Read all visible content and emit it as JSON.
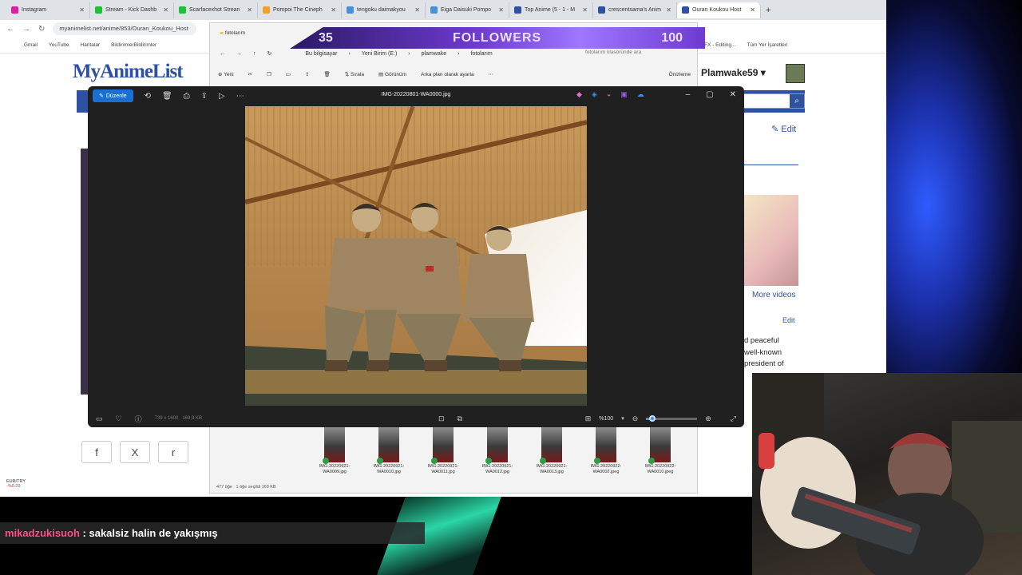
{
  "browser": {
    "tabs": [
      {
        "label": "Instagram",
        "color": "#d6249f"
      },
      {
        "label": "Stream - Kick Dashb",
        "color": "#1fbf3a"
      },
      {
        "label": "Scarfacexhot Strean",
        "color": "#1fbf3a"
      },
      {
        "label": "Pompoi The Cineph",
        "color": "#f0a030"
      },
      {
        "label": "tengoku daimakyou",
        "color": "#4a90d9"
      },
      {
        "label": "Eiga Daisuki Pompo",
        "color": "#4a90d9"
      },
      {
        "label": "Top Anime (5 - 1 - M",
        "color": "#2e51a2"
      },
      {
        "label": "crescentsama's Anim",
        "color": "#2e51a2"
      },
      {
        "label": "Ouran Koukou Host",
        "color": "#2e51a2"
      }
    ],
    "url": "myanimelist.net/anime/853/Ouran_Koukou_Host",
    "bookmarks": [
      "Gmail",
      "YouTube",
      "Haritalar",
      "BildirimlerBildirimler",
      "MATESFX - Editing...",
      "Tüm Yer İşaretleri"
    ]
  },
  "mal": {
    "logo": "MyAnimeList",
    "username": "Plamwake59",
    "edit": "Edit",
    "more_videos": "More videos",
    "edit2": "Edit",
    "synopsis": [
      "d peaceful",
      "well-known",
      "president of"
    ],
    "share_icons": [
      "f",
      "X",
      "r"
    ]
  },
  "eurtry": {
    "label": "EUR/TRY",
    "delta": "-%0.29"
  },
  "explorer": {
    "title": "fotolarım",
    "followers": {
      "left": "35",
      "label": "FOLLOWERS",
      "right": "100"
    },
    "breadcrumb": [
      "Bu bilgisayar",
      "Yeni Birim (E:)",
      "plamwake",
      "fotolarım"
    ],
    "search_placeholder": "fotolarım klasöründe ara",
    "toolbar": {
      "new": "Yeni",
      "sort": "Sırala",
      "view": "Görünüm",
      "background": "Arka plan olarak ayarla",
      "preview": "Önizleme"
    },
    "thumbnails": [
      "IMG-20220921-WA0009.jpg",
      "IMG-20220921-WA0010.jpg",
      "IMG-20220921-WA0011.jpg",
      "IMG-20220921-WA0012.jpg",
      "IMG-20220921-WA0013.jpg",
      "IMG-20220922-WA0002.jpeg",
      "IMG-20220922-WA0010.jpeg"
    ],
    "status": {
      "count": "477 öğe",
      "selected": "1 öğe seçildi  169 KB"
    }
  },
  "viewer": {
    "edit_label": "Düzenle",
    "filename": "IMG-20220801-WA0000.jpg",
    "dimensions": "739 x 1600",
    "filesize": "169,9 KB",
    "zoom_label": "%100",
    "zoom_level": 0.12
  },
  "chat": {
    "user": "mikadzukisuoh",
    "message": ": sakalsiz halin de yakışmış"
  }
}
